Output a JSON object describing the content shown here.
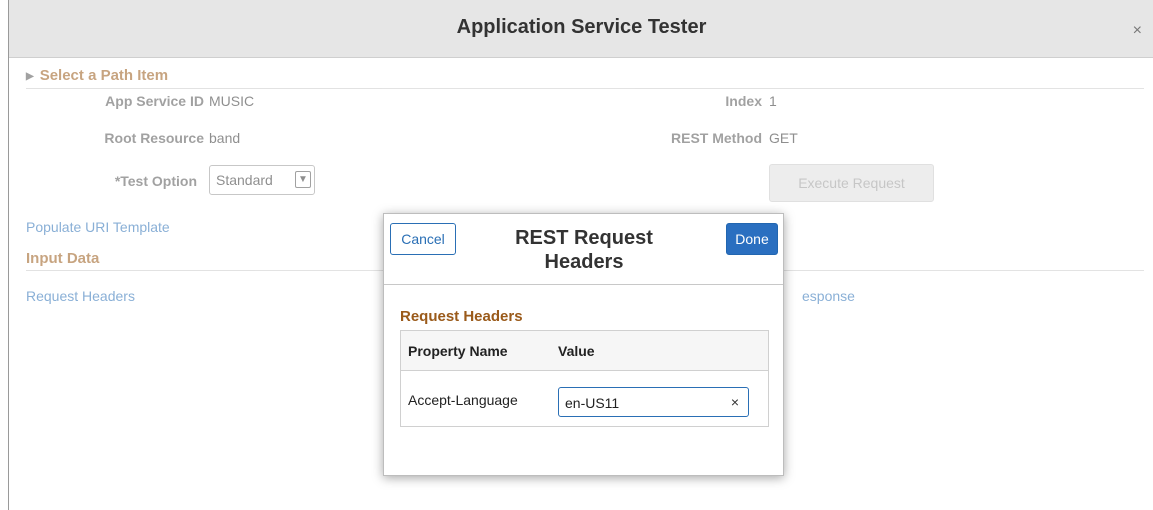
{
  "window": {
    "title": "Application Service Tester",
    "close_glyph": "×"
  },
  "path_item": {
    "heading": "Select a Path Item",
    "app_service_id": {
      "label": "App Service ID",
      "value": "MUSIC"
    },
    "index": {
      "label": "Index",
      "value": "1"
    },
    "root_resource": {
      "label": "Root Resource",
      "value": "band"
    },
    "rest_method": {
      "label": "REST Method",
      "value": "GET"
    },
    "test_option": {
      "label": "*Test Option",
      "value": "Standard"
    },
    "execute_label": "Execute Request"
  },
  "links": {
    "populate_uri": "Populate URI Template",
    "request_headers": "Request Headers",
    "response": "esponse"
  },
  "input_data": {
    "heading": "Input Data"
  },
  "modal": {
    "title": "REST Request Headers",
    "cancel_label": "Cancel",
    "done_label": "Done",
    "section": "Request Headers",
    "columns": [
      "Property Name",
      "Value"
    ],
    "rows": [
      {
        "property": "Accept-Language",
        "value": "en-US11"
      }
    ],
    "clear_glyph": "×"
  },
  "colors": {
    "accent_link": "#2a6fb5",
    "section_heading": "#9a5a1a",
    "primary_button": "#2a6fc0"
  }
}
